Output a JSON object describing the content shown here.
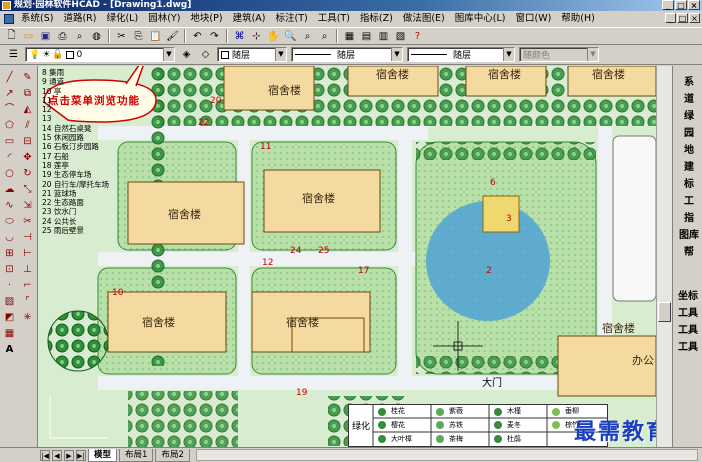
{
  "window": {
    "title": "规划·园林软件HCAD - [Drawing1.dwg]",
    "minimize": "_",
    "maximize": "□",
    "close": "×"
  },
  "menu": {
    "items": [
      "系统(S)",
      "道路(R)",
      "绿化(L)",
      "园林(Y)",
      "地块(P)",
      "建筑(A)",
      "标注(T)",
      "工具(T)",
      "指标(Z)",
      "做法图(E)",
      "图库中心(L)",
      "窗口(W)",
      "帮助(H)"
    ]
  },
  "toolbar": {
    "layer_value": "0",
    "color_value": "随层",
    "linetype_value": "随层",
    "lineweight_value": "随层",
    "plotstyle_value": "随颜色"
  },
  "annotation": {
    "bubble_text": "点击菜单浏览功能",
    "bubble_color": "#d00000"
  },
  "legend_items": [
    "8 集雨",
    "9 通道",
    "10 亭",
    "11 ",
    "12 ",
    "13 ",
    "14 自然石桌凳",
    "15 休闲园路",
    "16 石板汀步园路",
    "17 石船",
    "18 莲亭",
    "19 生态停车场",
    "20 自行车/摩托车场",
    "21 篮球场",
    "22 生态路面",
    "23 饮水门",
    "24 公共长",
    "25 雨后壁景"
  ],
  "drawing": {
    "buildings": [
      "宿舍楼",
      "宿舍楼",
      "宿舍楼",
      "宿舍楼",
      "宿舍楼",
      "宿舍楼",
      "宿舍楼",
      "宿舍楼",
      "宿舍楼",
      "办公"
    ],
    "gate_label": "大门",
    "numbers": [
      "20",
      "22",
      "11",
      "24",
      "25",
      "12",
      "17",
      "10",
      "19",
      "6",
      "3",
      "2"
    ],
    "legend_header": "绿化",
    "legend_cells": [
      "桂花",
      "樱花",
      "铺地",
      "苏铁",
      "茶梅",
      "棕竹",
      "大叶樟",
      "紫薇",
      "垂柳",
      "雪松",
      "麦冬",
      "木槿",
      "杜鹃",
      "凤尾竹"
    ]
  },
  "right_panel": {
    "vertical_items": [
      "系",
      "道",
      "绿",
      "园",
      "地",
      "建",
      "标",
      "工",
      "指",
      "图库",
      "帮"
    ],
    "lower_items": [
      "坐标",
      "工具",
      "工具",
      "工具"
    ]
  },
  "tabs": {
    "nav": [
      "|◀",
      "◀",
      "▶",
      "▶|"
    ],
    "items": [
      "模型",
      "布局1",
      "布局2"
    ]
  },
  "watermark": "最需教育",
  "colors": {
    "title_bar": "#0a246a",
    "canvas_bg": "#c8e6c0",
    "building": "#f4d9a0",
    "water": "#4a9fd8"
  }
}
